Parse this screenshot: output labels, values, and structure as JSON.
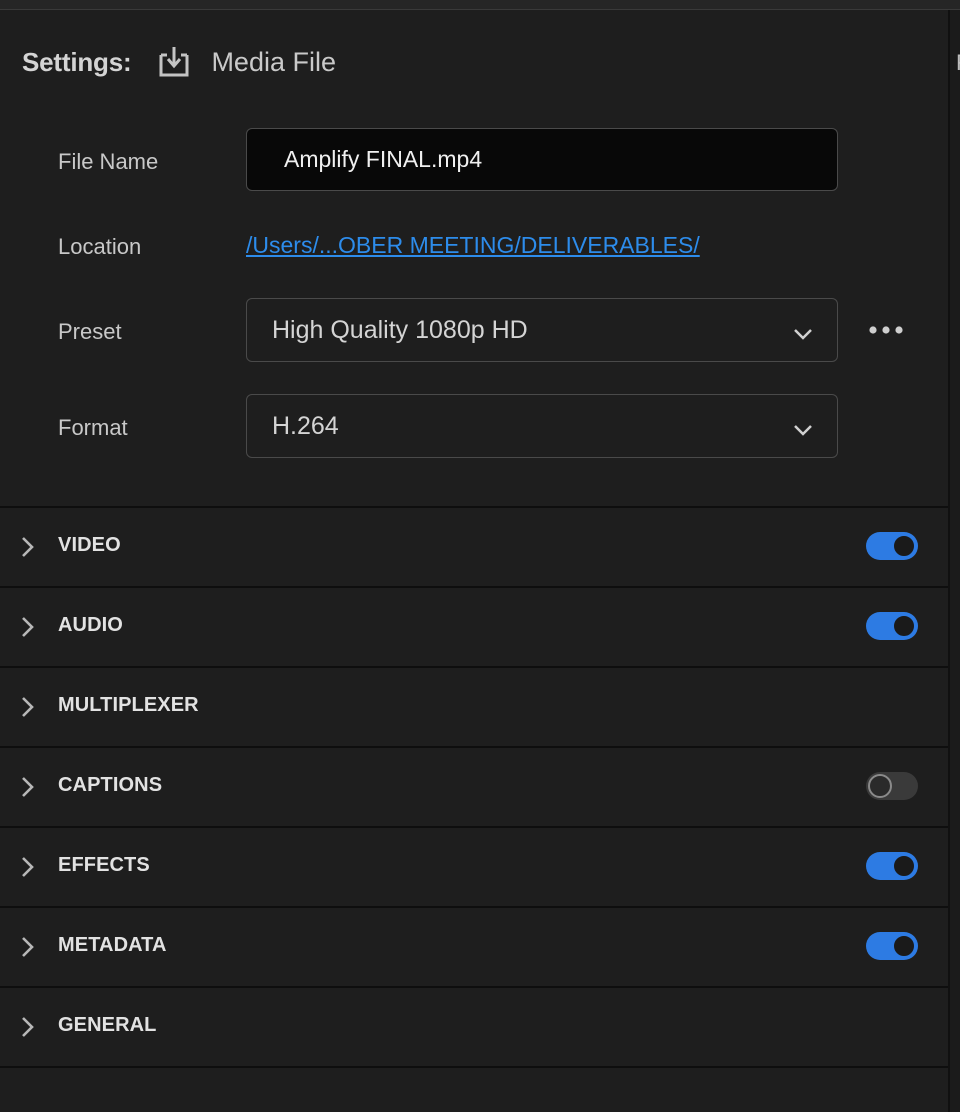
{
  "settings": {
    "label": "Settings:",
    "icon": "download-icon",
    "media_file_label": "Media File"
  },
  "fields": {
    "file_name": {
      "label": "File Name",
      "value": "Amplify FINAL.mp4"
    },
    "location": {
      "label": "Location",
      "value": "/Users/...OBER MEETING/DELIVERABLES/"
    },
    "preset": {
      "label": "Preset",
      "value": "High Quality 1080p HD"
    },
    "format": {
      "label": "Format",
      "value": "H.264"
    }
  },
  "sections": [
    {
      "label": "VIDEO",
      "toggle": "on"
    },
    {
      "label": "AUDIO",
      "toggle": "on"
    },
    {
      "label": "MULTIPLEXER",
      "toggle": "none"
    },
    {
      "label": "CAPTIONS",
      "toggle": "off"
    },
    {
      "label": "EFFECTS",
      "toggle": "on"
    },
    {
      "label": "METADATA",
      "toggle": "on"
    },
    {
      "label": "GENERAL",
      "toggle": "none"
    }
  ],
  "colors": {
    "accent": "#2d7be3",
    "link": "#2d8ceb",
    "background": "#1e1e1e"
  }
}
